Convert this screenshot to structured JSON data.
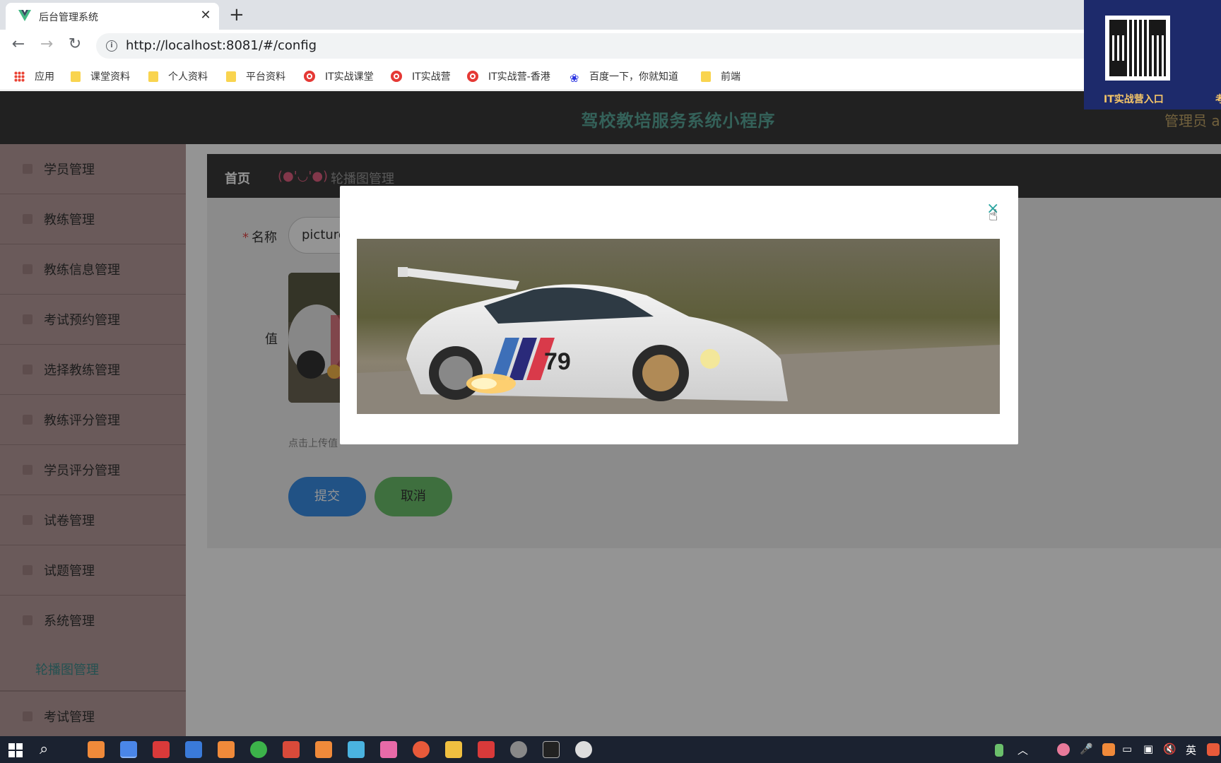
{
  "browser": {
    "tab_title": "后台管理系统",
    "url": "http://localhost:8081/#/config",
    "bookmarks": [
      {
        "label": "应用",
        "icon": "apps-grid-icon"
      },
      {
        "label": "课堂资料",
        "icon": "folder-icon"
      },
      {
        "label": "个人资料",
        "icon": "folder-icon"
      },
      {
        "label": "平台资料",
        "icon": "folder-icon"
      },
      {
        "label": "IT实战课堂",
        "icon": "site-icon"
      },
      {
        "label": "IT实战营",
        "icon": "site-icon"
      },
      {
        "label": "IT实战营-香港",
        "icon": "site-icon"
      },
      {
        "label": "百度一下，你就知道",
        "icon": "baidu-paw-icon"
      },
      {
        "label": "前端",
        "icon": "folder-icon"
      }
    ]
  },
  "qr_overlay": {
    "label": "IT实战营入口",
    "label_partial": "考"
  },
  "app": {
    "title": "驾校教培服务系统小程序",
    "admin": "管理员 a"
  },
  "sidebar": {
    "items": [
      {
        "label": "学员管理"
      },
      {
        "label": "教练管理"
      },
      {
        "label": "教练信息管理"
      },
      {
        "label": "考试预约管理"
      },
      {
        "label": "选择教练管理"
      },
      {
        "label": "教练评分管理"
      },
      {
        "label": "学员评分管理"
      },
      {
        "label": "试卷管理"
      },
      {
        "label": "试题管理"
      },
      {
        "label": "系统管理"
      }
    ],
    "active_sub": "轮播图管理",
    "last_item": "考试管理"
  },
  "breadcrumb": {
    "home": "首页",
    "separator": "(●'◡'●)",
    "current": "轮播图管理"
  },
  "form": {
    "name_label": "名称",
    "required_mark": "*",
    "name_value": "picture",
    "value_label": "值",
    "upload_hint": "点击上传值",
    "submit": "提交",
    "cancel": "取消"
  },
  "dialog": {
    "close_glyph": "×"
  },
  "colors": {
    "header_bg": "#3a3a3a",
    "title_teal": "#5aa89a",
    "sidebar_bg": "#b79c9c",
    "submit_blue": "#3a8ee6",
    "cancel_green": "#6bbf6b"
  },
  "taskbar": {
    "ime": "英"
  }
}
